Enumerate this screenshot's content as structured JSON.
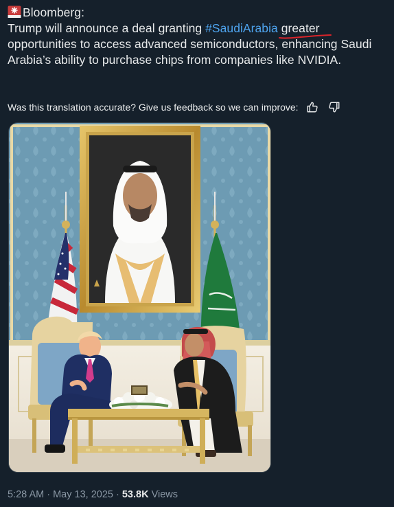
{
  "post": {
    "author_label": "Bloomberg:",
    "text_before_hashtag": "Trump will announce a deal granting ",
    "hashtag": "#SaudiArabia",
    "space": " ",
    "underlined_word": "greater",
    "text_after": " opportunities to access advanced semiconductors, enhancing Saudi Arabia’s ability to purchase chips from companies like NVIDIA.",
    "icon": "police-siren-icon"
  },
  "translation_feedback": {
    "prompt": "Was this translation accurate? Give us feedback so we can improve:",
    "thumbs_up_icon": "thumbs-up-icon",
    "thumbs_down_icon": "thumbs-down-icon"
  },
  "media": {
    "kind": "photo"
  },
  "meta": {
    "time": "5:28 AM",
    "separator": " · ",
    "date": "May 13, 2025",
    "views_count": "53.8K",
    "views_label": " Views"
  },
  "colors": {
    "background": "#15202b",
    "text": "#e7e9ea",
    "secondary": "#8b98a5",
    "link": "#4ea4ef",
    "annotation_underline": "#d8242a"
  }
}
